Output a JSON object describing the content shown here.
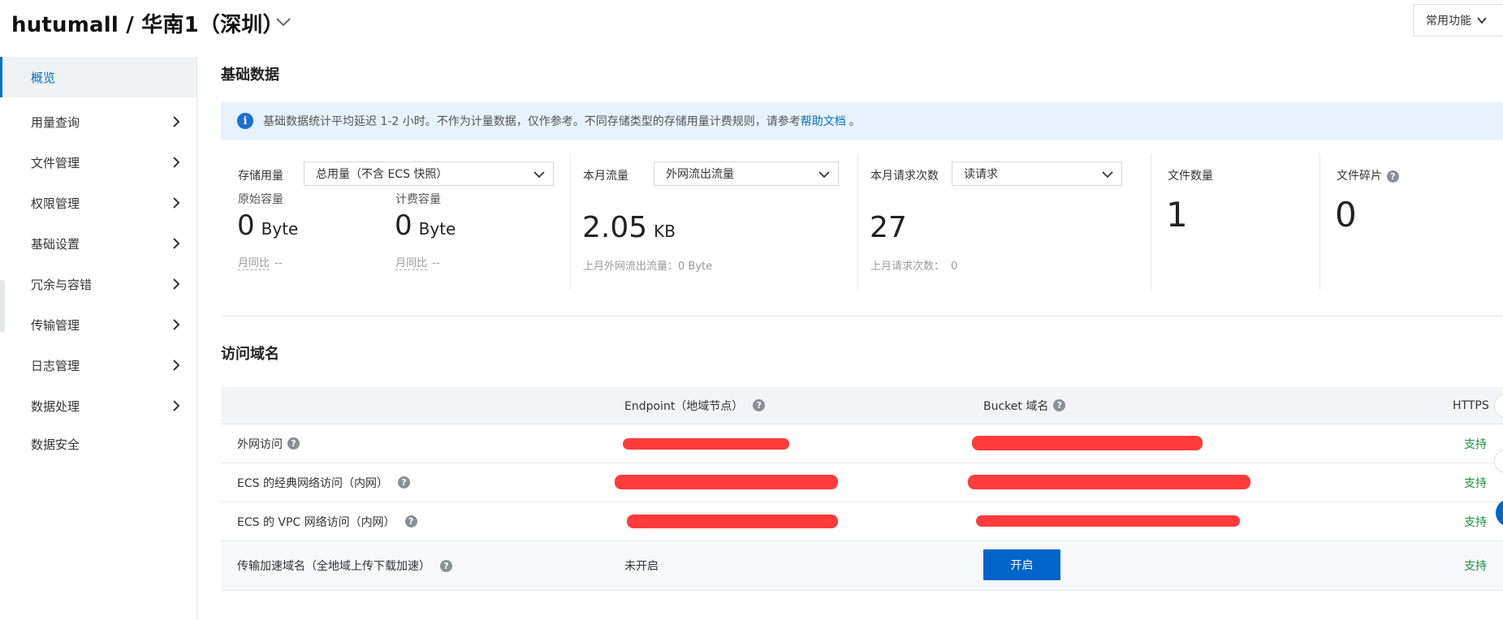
{
  "header": {
    "title": "hutumall / 华南1（深圳）",
    "common_functions": "常用功能"
  },
  "sidebar": {
    "items": [
      {
        "label": "概览",
        "active": true,
        "chevron": false
      },
      {
        "label": "用量查询",
        "chevron": true
      },
      {
        "label": "文件管理",
        "chevron": true
      },
      {
        "label": "权限管理",
        "chevron": true
      },
      {
        "label": "基础设置",
        "chevron": true
      },
      {
        "label": "冗余与容错",
        "chevron": true
      },
      {
        "label": "传输管理",
        "chevron": true
      },
      {
        "label": "日志管理",
        "chevron": true
      },
      {
        "label": "数据处理",
        "chevron": true
      },
      {
        "label": "数据安全",
        "chevron": false
      }
    ]
  },
  "basic": {
    "title": "基础数据",
    "notice": "基础数据统计平均延迟 1-2 小时。不作为计量数据，仅作参考。不同存储类型的存储用量计费规则，请参考",
    "notice_link": "帮助文档",
    "notice_end": "。",
    "storage": {
      "label": "存储用量",
      "select": "总用量（不含 ECS 快照）",
      "raw_label": "原始容量",
      "raw_value": "0",
      "raw_unit": "Byte",
      "raw_yoy": "月同比",
      "raw_yoy_value": "--",
      "bill_label": "计费容量",
      "bill_value": "0",
      "bill_unit": "Byte",
      "bill_yoy": "月同比",
      "bill_yoy_value": "--"
    },
    "traffic": {
      "label": "本月流量",
      "select": "外网流出流量",
      "value": "2.05",
      "unit": "KB",
      "last": "上月外网流出流量：0 Byte"
    },
    "requests": {
      "label": "本月请求次数",
      "select": "读请求",
      "value": "27",
      "last_label": "上月请求次数：",
      "last_value": "0"
    },
    "files": {
      "label": "文件数量",
      "value": "1"
    },
    "fragments": {
      "label": "文件碎片",
      "value": "0"
    }
  },
  "domains": {
    "title": "访问域名",
    "headers": {
      "endpoint": "Endpoint（地域节点）",
      "bucket": "Bucket 域名",
      "https": "HTTPS"
    },
    "rows": [
      {
        "name": "外网访问",
        "https": "支持"
      },
      {
        "name": "ECS 的经典网络访问（内网）",
        "https": "支持"
      },
      {
        "name": "ECS 的 VPC 网络访问（内网）",
        "https": "支持"
      },
      {
        "name": "传输加速域名（全地域上传下载加速）",
        "endpoint": "未开启",
        "button": "开启",
        "https": "支持"
      }
    ]
  },
  "colors": {
    "accent": "#0070cc",
    "button": "#0064c8",
    "success": "#1e8e3e",
    "notice_bg": "#e7f2fc",
    "redaction": "#ff3b3b"
  }
}
